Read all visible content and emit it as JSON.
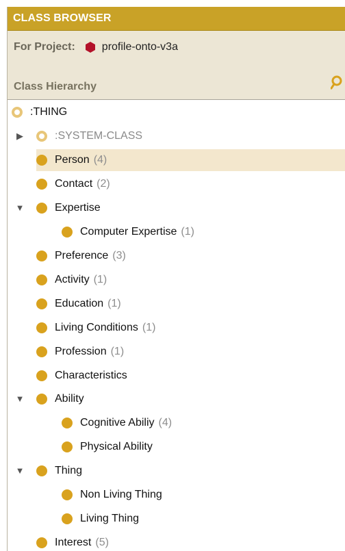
{
  "titlebar": {
    "title": "CLASS BROWSER"
  },
  "project": {
    "label": "For Project:",
    "name": "profile-onto-v3a"
  },
  "hierarchy": {
    "label": "Class Hierarchy"
  },
  "tree": [
    {
      "label": ":THING",
      "count": "",
      "toggle": "",
      "icon": "class-hollow-icon"
    },
    {
      "label": ":SYSTEM-CLASS",
      "count": "",
      "toggle": "▶",
      "icon": "class-hollow-icon"
    },
    {
      "label": "Person",
      "count": "(4)",
      "toggle": "",
      "icon": "class-icon",
      "selected": true
    },
    {
      "label": "Contact",
      "count": "(2)",
      "toggle": "",
      "icon": "class-icon"
    },
    {
      "label": "Expertise",
      "count": "",
      "toggle": "▼",
      "icon": "class-icon"
    },
    {
      "label": "Computer Expertise",
      "count": "(1)",
      "toggle": "",
      "icon": "class-icon"
    },
    {
      "label": "Preference",
      "count": "(3)",
      "toggle": "",
      "icon": "class-icon"
    },
    {
      "label": "Activity",
      "count": "(1)",
      "toggle": "",
      "icon": "class-icon"
    },
    {
      "label": "Education",
      "count": "(1)",
      "toggle": "",
      "icon": "class-icon"
    },
    {
      "label": "Living Conditions",
      "count": "(1)",
      "toggle": "",
      "icon": "class-icon"
    },
    {
      "label": "Profession",
      "count": "(1)",
      "toggle": "",
      "icon": "class-icon"
    },
    {
      "label": "Characteristics",
      "count": "",
      "toggle": "",
      "icon": "class-icon"
    },
    {
      "label": "Ability",
      "count": "",
      "toggle": "▼",
      "icon": "class-icon"
    },
    {
      "label": "Cognitive Abiliy",
      "count": "(4)",
      "toggle": "",
      "icon": "class-icon"
    },
    {
      "label": "Physical Ability",
      "count": "",
      "toggle": "",
      "icon": "class-icon"
    },
    {
      "label": "Thing",
      "count": "",
      "toggle": "▼",
      "icon": "class-icon"
    },
    {
      "label": "Non Living Thing",
      "count": "",
      "toggle": "",
      "icon": "class-icon"
    },
    {
      "label": "Living Thing",
      "count": "",
      "toggle": "",
      "icon": "class-icon"
    },
    {
      "label": "Interest",
      "count": "(5)",
      "toggle": "",
      "icon": "class-icon"
    }
  ],
  "colors": {
    "titlebar": "#c9a227",
    "panel": "#ece6d5",
    "class_icon": "#d9a21e",
    "project_icon": "#b3122a",
    "selection": "#f3e7cd"
  }
}
